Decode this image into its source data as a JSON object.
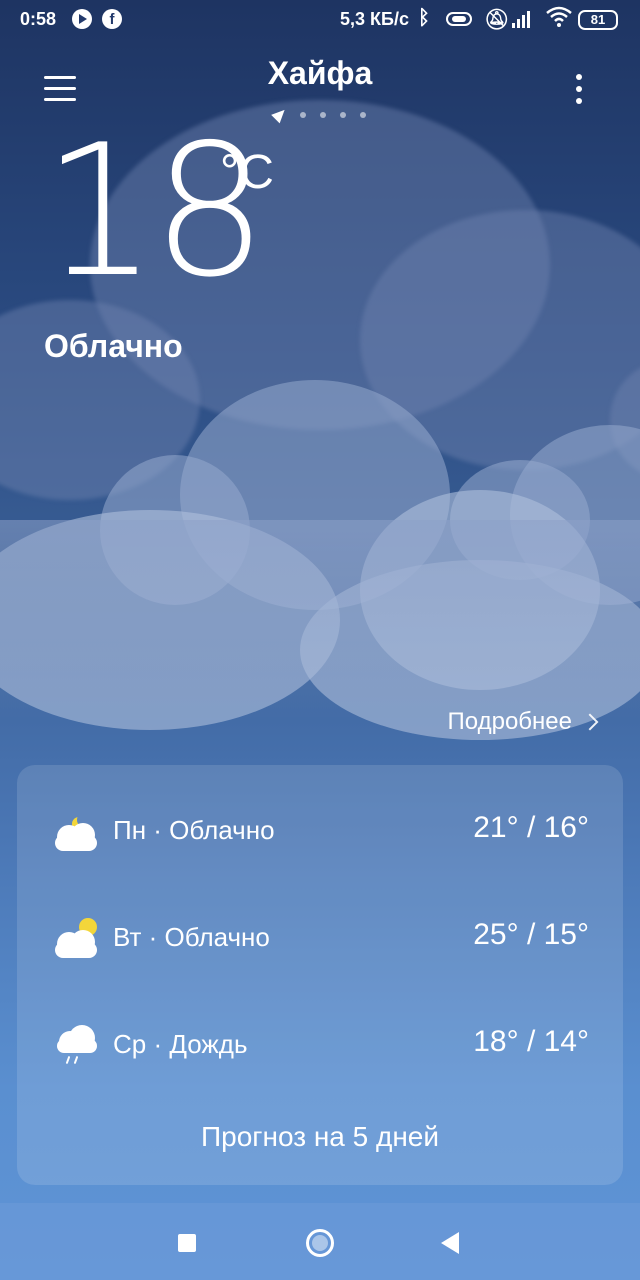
{
  "status_bar": {
    "time": "0:58",
    "speed": "5,3 КБ/с",
    "battery": "81",
    "icons": [
      "play-icon",
      "facebook-icon",
      "bluetooth-icon",
      "vibrate-icon",
      "mute-icon",
      "signal-icon",
      "wifi-icon",
      "battery-icon"
    ]
  },
  "header": {
    "city": "Хайфа",
    "page_count": 5,
    "current_page": 1
  },
  "current": {
    "temperature": "18",
    "unit": "°C",
    "condition": "Облачно"
  },
  "details_link": "Подробнее",
  "forecast": [
    {
      "day": "Пн · Облачно",
      "temps": "21° / 16°",
      "icon": "cloudy-night-icon"
    },
    {
      "day": "Вт · Облачно",
      "temps": "25° / 15°",
      "icon": "cloudy-sun-icon"
    },
    {
      "day": "Ср · Дождь",
      "temps": "18° / 14°",
      "icon": "rain-icon"
    }
  ],
  "five_day_button": "Прогноз на 5 дней",
  "colors": {
    "sky_top": "#1e3462",
    "sky_bottom": "#5f94d6",
    "sun": "#f3d63a"
  }
}
